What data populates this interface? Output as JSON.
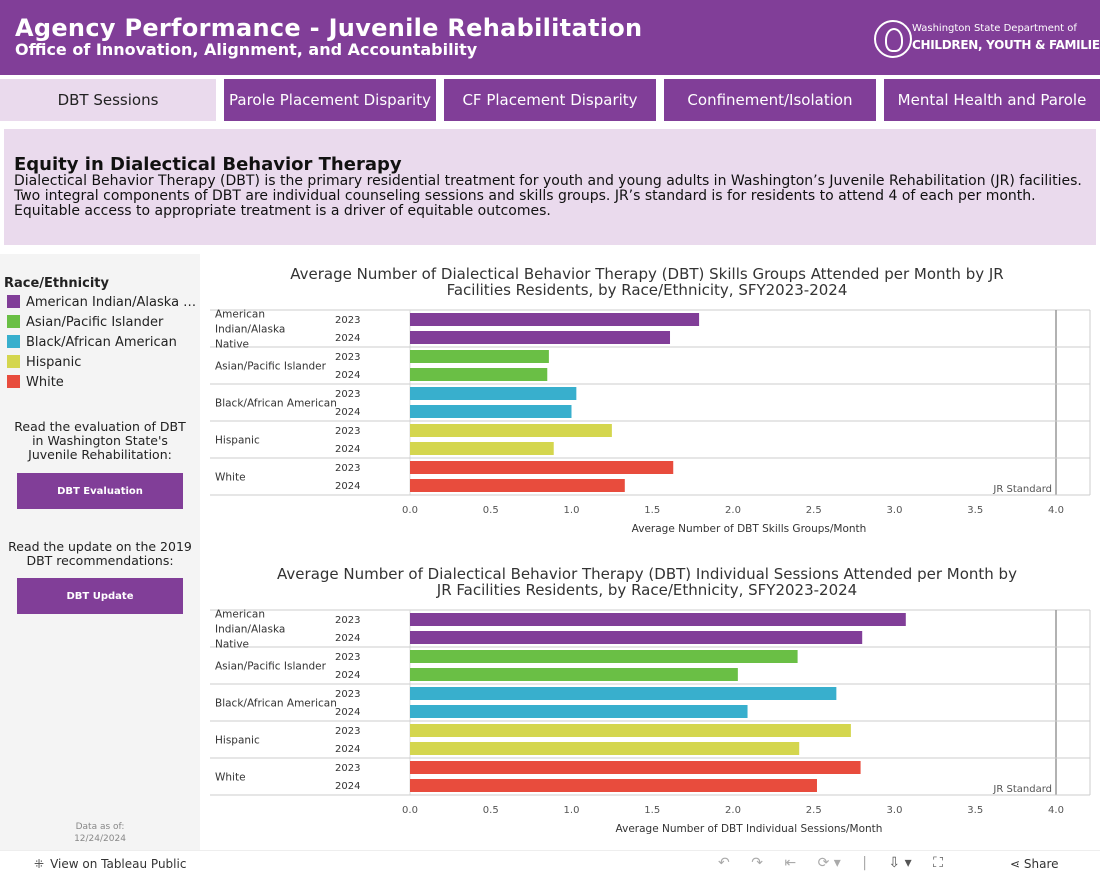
{
  "header": {
    "title": "Agency Performance - Juvenile Rehabilitation",
    "subtitle": "Office of Innovation, Alignment, and Accountability",
    "logo_line1": "Washington State Department of",
    "logo_line2": "CHILDREN, YOUTH & FAMILIES"
  },
  "tabs": [
    {
      "label": "DBT Sessions",
      "active": true
    },
    {
      "label": "Parole Placement Disparity",
      "active": false
    },
    {
      "label": "CF Placement Disparity",
      "active": false
    },
    {
      "label": "Confinement/Isolation",
      "active": false
    },
    {
      "label": "Mental Health and Parole",
      "active": false
    }
  ],
  "intro": {
    "heading": "Equity in Dialectical Behavior Therapy",
    "body": "Dialectical Behavior Therapy (DBT) is the primary residential treatment for youth and young adults in Washington’s Juvenile Rehabilitation (JR) facilities. Two integral components of DBT are individual counseling sessions and skills groups. JR’s standard is for residents to attend 4 of each per month. Equitable access to appropriate treatment is a driver of equitable outcomes."
  },
  "legend": {
    "title": "Race/Ethnicity",
    "items": [
      {
        "label": "American Indian/Alaska Native",
        "color": "#813e98"
      },
      {
        "label": "Asian/Pacific Islander",
        "color": "#6abf45"
      },
      {
        "label": "Black/African American",
        "color": "#38afcd"
      },
      {
        "label": "Hispanic",
        "color": "#d4d64e"
      },
      {
        "label": "White",
        "color": "#e84c3d"
      }
    ]
  },
  "sidebar": {
    "eval_text": "Read the evaluation of DBT in Washington State's Juvenile Rehabilitation:",
    "eval_button": "DBT Evaluation",
    "update_text": "Read the update on the 2019 DBT recommendations:",
    "update_button": "DBT Update",
    "data_as_of_label": "Data as of:",
    "data_as_of_date": "12/24/2024"
  },
  "chart_data": [
    {
      "type": "bar",
      "orientation": "horizontal",
      "title": "Average Number of Dialectical Behavior Therapy (DBT) Skills Groups Attended per Month by JR Facilities Residents, by Race/Ethnicity, SFY2023-2024",
      "xlabel": "Average Number of DBT Skills Groups/Month",
      "xlim": [
        0,
        4.2
      ],
      "xticks": [
        "0.0",
        "0.5",
        "1.0",
        "1.5",
        "2.0",
        "2.5",
        "3.0",
        "3.5",
        "4.0"
      ],
      "reference_line": {
        "value": 4.0,
        "label": "JR Standard"
      },
      "groups": [
        {
          "label": "American Indian/Alaska Native",
          "color": "#813e98",
          "bars": [
            {
              "year": "2023",
              "value": 1.79
            },
            {
              "year": "2024",
              "value": 1.61
            }
          ]
        },
        {
          "label": "Asian/Pacific Islander",
          "color": "#6abf45",
          "bars": [
            {
              "year": "2023",
              "value": 0.86
            },
            {
              "year": "2024",
              "value": 0.85
            }
          ]
        },
        {
          "label": "Black/African American",
          "color": "#38afcd",
          "bars": [
            {
              "year": "2023",
              "value": 1.03
            },
            {
              "year": "2024",
              "value": 1.0
            }
          ]
        },
        {
          "label": "Hispanic",
          "color": "#d4d64e",
          "bars": [
            {
              "year": "2023",
              "value": 1.25
            },
            {
              "year": "2024",
              "value": 0.89
            }
          ]
        },
        {
          "label": "White",
          "color": "#e84c3d",
          "bars": [
            {
              "year": "2023",
              "value": 1.63
            },
            {
              "year": "2024",
              "value": 1.33
            }
          ]
        }
      ]
    },
    {
      "type": "bar",
      "orientation": "horizontal",
      "title": "Average Number of Dialectical Behavior Therapy (DBT) Individual Sessions Attended per Month by JR Facilities Residents, by Race/Ethnicity, SFY2023-2024",
      "xlabel": "Average Number of DBT Individual Sessions/Month",
      "xlim": [
        0,
        4.2
      ],
      "xticks": [
        "0.0",
        "0.5",
        "1.0",
        "1.5",
        "2.0",
        "2.5",
        "3.0",
        "3.5",
        "4.0"
      ],
      "reference_line": {
        "value": 4.0,
        "label": "JR Standard"
      },
      "groups": [
        {
          "label": "American Indian/Alaska Native",
          "color": "#813e98",
          "bars": [
            {
              "year": "2023",
              "value": 3.07
            },
            {
              "year": "2024",
              "value": 2.8
            }
          ]
        },
        {
          "label": "Asian/Pacific Islander",
          "color": "#6abf45",
          "bars": [
            {
              "year": "2023",
              "value": 2.4
            },
            {
              "year": "2024",
              "value": 2.03
            }
          ]
        },
        {
          "label": "Black/African American",
          "color": "#38afcd",
          "bars": [
            {
              "year": "2023",
              "value": 2.64
            },
            {
              "year": "2024",
              "value": 2.09
            }
          ]
        },
        {
          "label": "Hispanic",
          "color": "#d4d64e",
          "bars": [
            {
              "year": "2023",
              "value": 2.73
            },
            {
              "year": "2024",
              "value": 2.41
            }
          ]
        },
        {
          "label": "White",
          "color": "#e84c3d",
          "bars": [
            {
              "year": "2023",
              "value": 2.79
            },
            {
              "year": "2024",
              "value": 2.52
            }
          ]
        }
      ]
    }
  ],
  "footer": {
    "tableau_link": "View on Tableau Public",
    "share_label": "Share"
  }
}
